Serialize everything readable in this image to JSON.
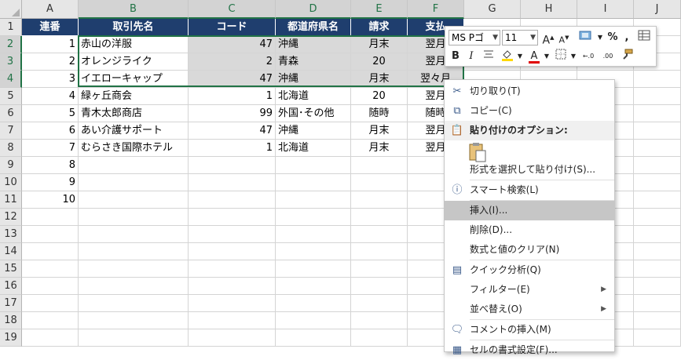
{
  "columns": [
    "A",
    "B",
    "C",
    "D",
    "E",
    "F",
    "G",
    "H",
    "I",
    "J"
  ],
  "rows": [
    "1",
    "2",
    "3",
    "4",
    "5",
    "6",
    "7",
    "8",
    "9",
    "10",
    "11",
    "12",
    "13",
    "14",
    "15",
    "16",
    "17",
    "18",
    "19"
  ],
  "header_row": [
    "連番",
    "取引先名",
    "コード",
    "都道府県名",
    "請求",
    "支払"
  ],
  "data_rows": [
    [
      "1",
      "赤山の洋服",
      "47",
      "沖縄",
      "月末",
      "翌月"
    ],
    [
      "2",
      "オレンジライク",
      "2",
      "青森",
      "20",
      "翌月"
    ],
    [
      "3",
      "イエローキャップ",
      "47",
      "沖縄",
      "月末",
      "翌々月"
    ],
    [
      "4",
      "緑ヶ丘商会",
      "1",
      "北海道",
      "20",
      "翌月"
    ],
    [
      "5",
      "青木太郎商店",
      "99",
      "外国･その他",
      "随時",
      "随時"
    ],
    [
      "6",
      "あい介護サポート",
      "47",
      "沖縄",
      "月末",
      "翌月"
    ],
    [
      "7",
      "むらさき国際ホテル",
      "1",
      "北海道",
      "月末",
      "翌月"
    ],
    [
      "8",
      "",
      "",
      "",
      "",
      ""
    ],
    [
      "9",
      "",
      "",
      "",
      "",
      ""
    ],
    [
      "10",
      "",
      "",
      "",
      "",
      ""
    ]
  ],
  "mini_toolbar": {
    "font": "MS Pゴ",
    "size": "11",
    "grow": "A",
    "shrink": "A",
    "percent": "%",
    "comma": ",",
    "bold": "B",
    "italic": "I",
    "font_color_glyph": "A",
    "dec_inc": "←.0",
    "dec_dec": ".00",
    "accent_red": "#e00000",
    "accent_yellow": "#ffd800"
  },
  "context_menu": {
    "items": [
      {
        "label": "切り取り(T)",
        "icon": "cut-icon"
      },
      {
        "label": "コピー(C)",
        "icon": "copy-icon"
      },
      {
        "label": "貼り付けのオプション:",
        "icon": "paste-icon"
      },
      {
        "label": "形式を選択して貼り付け(S)...",
        "icon": ""
      },
      {
        "label": "スマート検索(L)",
        "icon": "info-icon"
      },
      {
        "label": "挿入(I)...",
        "icon": ""
      },
      {
        "label": "削除(D)...",
        "icon": ""
      },
      {
        "label": "数式と値のクリア(N)",
        "icon": ""
      },
      {
        "label": "クイック分析(Q)",
        "icon": "quick-analysis-icon"
      },
      {
        "label": "フィルター(E)",
        "icon": ""
      },
      {
        "label": "並べ替え(O)",
        "icon": ""
      },
      {
        "label": "コメントの挿入(M)",
        "icon": "comment-icon"
      },
      {
        "label": "セルの書式設定(F)...",
        "icon": "format-cells-icon"
      }
    ]
  },
  "colors": {
    "header_bg": "#1f3e6e",
    "selection_border": "#217346",
    "menu_highlight": "#c6c6c6"
  }
}
